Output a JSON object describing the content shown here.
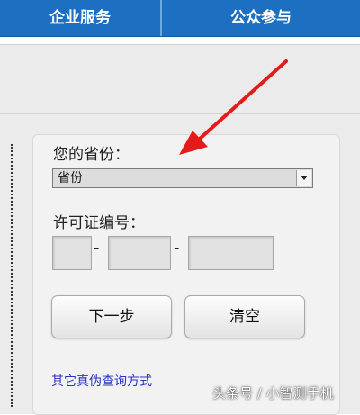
{
  "nav": {
    "items": [
      {
        "label": "企业服务"
      },
      {
        "label": "公众参与"
      }
    ]
  },
  "form": {
    "province_label": "您的省份：",
    "province_select_value": "省份",
    "license_label": "许可证编号：",
    "dash": "-",
    "next_button": "下一步",
    "clear_button": "清空",
    "alt_link": "其它真伪查询方式"
  },
  "watermark": "头条号 / 小智测手机",
  "colors": {
    "nav_bar": "#1c6fc1",
    "annotation_arrow": "#e41b1b",
    "link": "#2c33c4"
  }
}
